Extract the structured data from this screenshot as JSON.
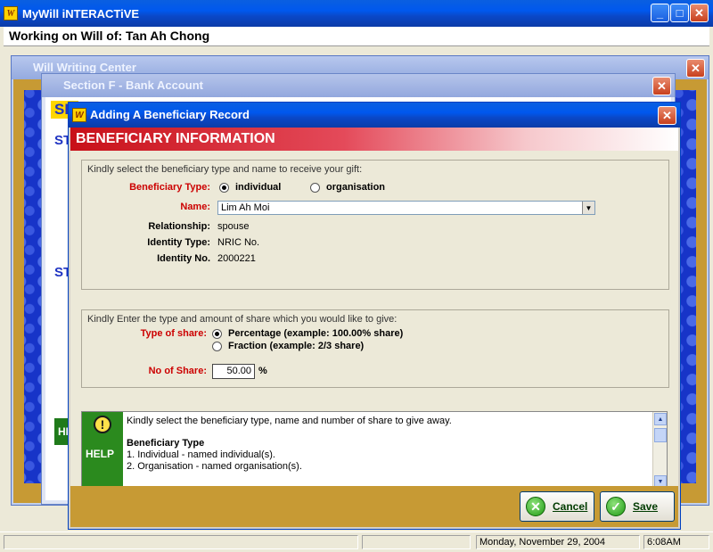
{
  "app": {
    "title": "MyWill iNTERACTiVE",
    "icon_letter": "W"
  },
  "workbar": {
    "label": "Working on Will of: Tan Ah Chong"
  },
  "bg_window_1": {
    "title": "Will Writing Center"
  },
  "bg_window_2": {
    "title": "Section F - Bank Account",
    "fragments": [
      "SE",
      "ST",
      "ST",
      "HI",
      "S"
    ]
  },
  "dialog": {
    "title": "Adding A Beneficiary Record",
    "header": "BENEFICIARY INFORMATION",
    "group1": {
      "caption": "Kindly select the beneficiary type and name to receive your gift:",
      "type_label": "Beneficiary Type:",
      "type_options": [
        "individual",
        "organisation"
      ],
      "type_selected": "individual",
      "name_label": "Name:",
      "name_value": "Lim Ah Moi",
      "relationship_label": "Relationship:",
      "relationship_value": "spouse",
      "idtype_label": "Identity Type:",
      "idtype_value": "NRIC No.",
      "idno_label": "Identity No.",
      "idno_value": "2000221"
    },
    "group2": {
      "caption": "Kindly Enter the type and amount of share which you would like to give:",
      "share_type_label": "Type of share:",
      "share_options": [
        "Percentage (example:   100.00% share)",
        "Fraction (example: 2/3 share)"
      ],
      "share_selected": "Percentage",
      "no_share_label": "No of Share:",
      "no_share_value": "50.00",
      "unit": "%"
    },
    "help": {
      "label": "HELP",
      "intro": "Kindly select the beneficiary type, name and number of share to give away.",
      "heading": "Beneficiary Type",
      "items": [
        "1. Individual - named individual(s).",
        "2. Organisation - named organisation(s)."
      ]
    },
    "buttons": {
      "cancel": "Cancel",
      "save": "Save"
    }
  },
  "status": {
    "date": "Monday, November 29, 2004",
    "time": "6:08AM"
  },
  "colors": {
    "title_blue": "#0058ee",
    "header_red": "#c81018",
    "required_red": "#cc0000",
    "frame_gold": "#c79a34",
    "help_green": "#2b8a1e"
  }
}
